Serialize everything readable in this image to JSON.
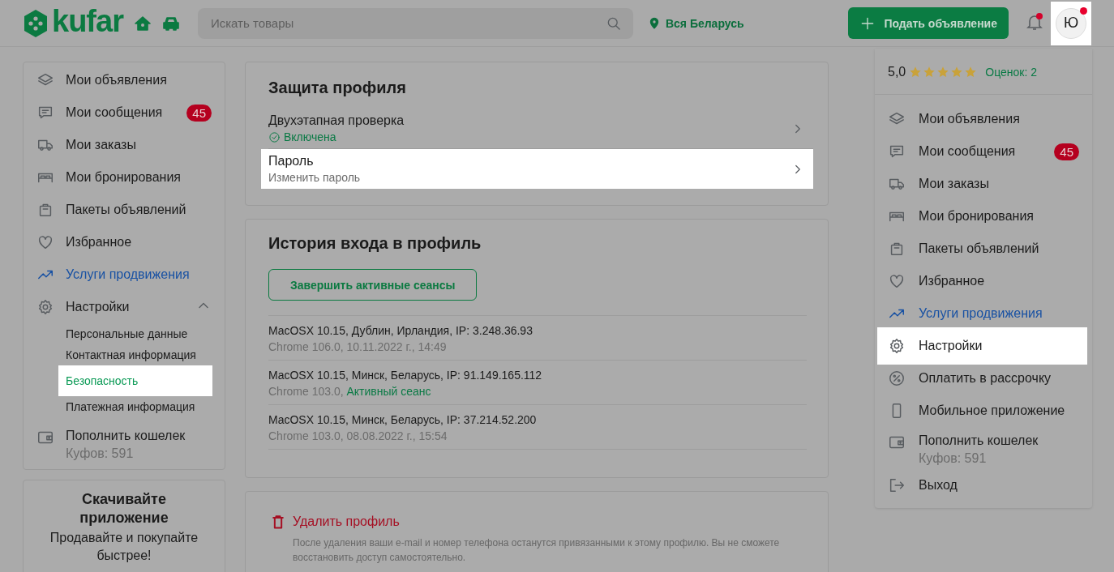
{
  "header": {
    "logo": "kufar",
    "search": {
      "placeholder": "Искать товары"
    },
    "location": "Вся Беларусь",
    "post_button": "Подать объявление",
    "avatar": {
      "letter": "Ю",
      "highlighted": true
    }
  },
  "sidebar": {
    "items": [
      {
        "kind": "link",
        "label": "Мои объявления"
      },
      {
        "kind": "link",
        "label": "Мои сообщения",
        "badge": "45"
      },
      {
        "kind": "link",
        "label": "Мои заказы"
      },
      {
        "kind": "link",
        "label": "Мои бронирования"
      },
      {
        "kind": "link",
        "label": "Пакеты объявлений"
      },
      {
        "kind": "link",
        "label": "Избранное"
      },
      {
        "kind": "promo",
        "label": "Услуги продвижения"
      },
      {
        "kind": "group",
        "label": "Настройки",
        "expanded": true,
        "children": [
          {
            "label": "Персональные данные",
            "selected": false,
            "highlighted": false
          },
          {
            "label": "Контактная информация",
            "selected": false,
            "highlighted": false
          },
          {
            "label": "Безопасность",
            "selected": true,
            "highlighted": true
          },
          {
            "label": "Платежная информация",
            "selected": false,
            "highlighted": false
          }
        ]
      },
      {
        "kind": "wallet",
        "label": "Пополнить кошелек",
        "sub": "Куфов: 591"
      }
    ]
  },
  "app_promo": {
    "title": "Скачивайте приложение",
    "text": "Продавайте и покупайте быстрее!"
  },
  "security": {
    "title": "Защита профиля",
    "items": [
      {
        "title": "Двухэтапная проверка",
        "status": "Включена",
        "highlighted": false
      },
      {
        "title": "Пароль",
        "subtitle": "Изменить пароль",
        "highlighted": true
      }
    ]
  },
  "history": {
    "title": "История входа в профиль",
    "button": "Завершить активные сеансы",
    "sessions": [
      {
        "device": "MacOSX 10.15, Дублин, Ирландия, IP: 3.248.36.93",
        "detail": "Chrome 106.0, 10.11.2022 г., 14:49"
      },
      {
        "device": "MacOSX 10.15, Минск, Беларусь, IP: 91.149.165.112",
        "detail": "Chrome 103.0,",
        "status": "Активный сеанс"
      },
      {
        "device": "MacOSX 10.15, Минск, Беларусь, IP: 37.214.52.200",
        "detail": "Chrome 103.0, 08.08.2022 г., 15:54"
      }
    ]
  },
  "delete": {
    "title": "Удалить профиль",
    "note": "После удаления ваши e-mail и номер телефона останутся привязанными к этому профилю. Вы не сможете восстановить доступ самостоятельно."
  },
  "user_menu": {
    "rating": "5,0",
    "stars": 5,
    "reviews": "Оценок: 2",
    "items": [
      {
        "kind": "link",
        "label": "Мои объявления",
        "highlighted": false
      },
      {
        "kind": "link",
        "label": "Мои сообщения",
        "badge": "45",
        "highlighted": false
      },
      {
        "kind": "link",
        "label": "Мои заказы",
        "highlighted": false
      },
      {
        "kind": "link",
        "label": "Мои бронирования",
        "highlighted": false
      },
      {
        "kind": "link",
        "label": "Пакеты объявлений",
        "highlighted": false
      },
      {
        "kind": "link",
        "label": "Избранное",
        "highlighted": false
      },
      {
        "kind": "promo",
        "label": "Услуги продвижения",
        "highlighted": false
      },
      {
        "kind": "link",
        "label": "Настройки",
        "highlighted": true
      },
      {
        "kind": "link",
        "label": "Оплатить в рассрочку",
        "highlighted": false
      },
      {
        "kind": "link",
        "label": "Мобильное приложение",
        "highlighted": false
      },
      {
        "kind": "wallet",
        "label": "Пополнить кошелек",
        "sub": "Куфов: 591",
        "highlighted": false
      },
      {
        "kind": "link",
        "label": "Выход",
        "highlighted": false
      }
    ]
  }
}
